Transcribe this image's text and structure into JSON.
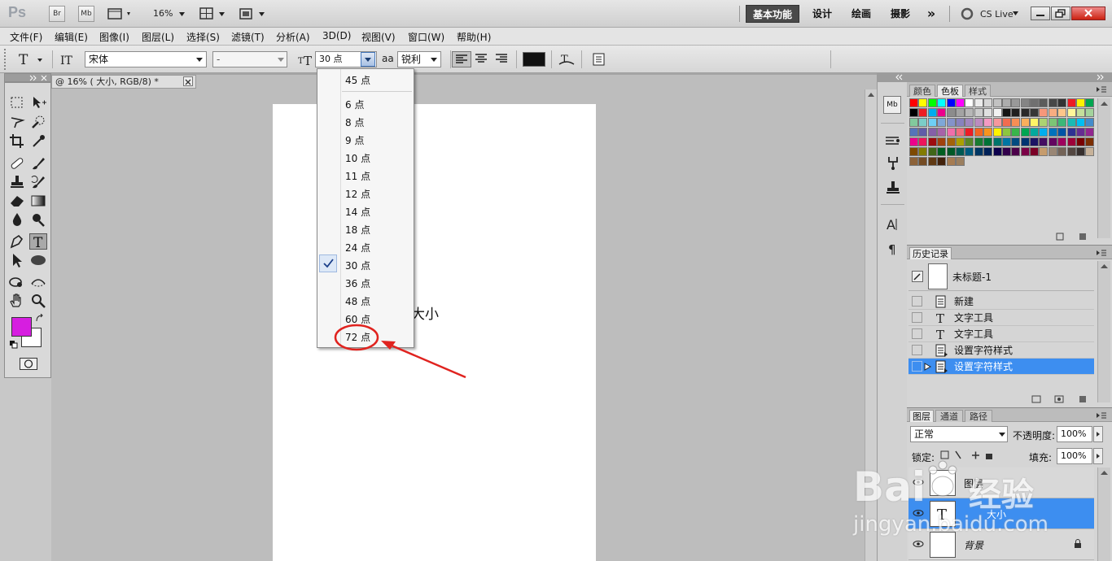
{
  "app": {
    "logo": "Ps",
    "bridge_btn": "Br",
    "minibridge_btn": "Mb",
    "zoom": "16%"
  },
  "workspaces": [
    {
      "label": "基本功能",
      "active": true
    },
    {
      "label": "设计",
      "active": false
    },
    {
      "label": "绘画",
      "active": false
    },
    {
      "label": "摄影",
      "active": false
    }
  ],
  "workspaces_more": "»",
  "cs_live": "CS Live",
  "menu": [
    "文件(F)",
    "编辑(E)",
    "图像(I)",
    "图层(L)",
    "选择(S)",
    "滤镜(T)",
    "分析(A)",
    "3D(D)",
    "视图(V)",
    "窗口(W)",
    "帮助(H)"
  ],
  "options": {
    "font_family": "宋体",
    "font_style": "-",
    "font_size": "30 点",
    "aa_label": "aa",
    "antialias": "锐利",
    "text_color": "#111111"
  },
  "document": {
    "tab_title": "@ 16% (        大小, RGB/8) *",
    "canvas_text": "大小"
  },
  "font_size_menu": {
    "top_item": "45 点",
    "items": [
      "6 点",
      "8 点",
      "9 点",
      "10 点",
      "11 点",
      "12 点",
      "14 点",
      "18 点",
      "24 点",
      "30 点",
      "36 点",
      "48 点",
      "60 点",
      "72 点"
    ],
    "checked": "30 点",
    "highlighted": "72 点"
  },
  "colors": {
    "foreground": "#d61ee0",
    "background": "#ffffff",
    "selection": "#3d8ef0",
    "annotation": "#e0231f"
  },
  "swatch_panel": {
    "tabs": [
      "颜色",
      "色板",
      "样式"
    ],
    "active_tab": "色板",
    "swatches": [
      "#ff0000",
      "#ffff00",
      "#00ff00",
      "#00ffff",
      "#0000ff",
      "#ff00ff",
      "#ffffff",
      "#ebebeb",
      "#d6d6d6",
      "#c2c2c2",
      "#adadad",
      "#999999",
      "#858585",
      "#707070",
      "#5c5c5c",
      "#474747",
      "#333333",
      "#ed1c24",
      "#fff200",
      "#00a651",
      "#000000",
      "#ee1d24",
      "#00adef",
      "#ec008c",
      "#8c8c8c",
      "#a3a3a3",
      "#b7b7b7",
      "#cccccc",
      "#e0e0e0",
      "#f2f2f2",
      "#141414",
      "#1f1f1f",
      "#292929",
      "#363636",
      "#f7977a",
      "#f9ad81",
      "#fdc68a",
      "#fff79a",
      "#c4df9b",
      "#a3d39c",
      "#82ca9d",
      "#7bcdc8",
      "#6ecff6",
      "#7ea7d8",
      "#8493ca",
      "#8882be",
      "#a187be",
      "#bc8cbf",
      "#f49ac2",
      "#f6989d",
      "#f26c4f",
      "#f68e55",
      "#fbaf5c",
      "#fff467",
      "#acd372",
      "#7cc576",
      "#3bb878",
      "#1abbb4",
      "#00bff3",
      "#438ccb",
      "#5574b9",
      "#605ca8",
      "#855fa8",
      "#a763a8",
      "#f06eaa",
      "#f26d7d",
      "#ed1c24",
      "#f26522",
      "#f7941d",
      "#fff200",
      "#8dc63f",
      "#39b54a",
      "#00a651",
      "#00a99d",
      "#00aeef",
      "#0072bc",
      "#0054a6",
      "#2e3192",
      "#662d91",
      "#92278f",
      "#ec008c",
      "#ed145b",
      "#9e0b0f",
      "#a0410d",
      "#a3620a",
      "#aba000",
      "#598527",
      "#197b30",
      "#007236",
      "#00746b",
      "#0076a3",
      "#004b80",
      "#003471",
      "#1b1464",
      "#440e62",
      "#630460",
      "#9e005d",
      "#9e0039",
      "#790000",
      "#7b2e00",
      "#7d4900",
      "#827b00",
      "#406618",
      "#005e20",
      "#005826",
      "#005952",
      "#005b7f",
      "#003663",
      "#002157",
      "#0d004c",
      "#32004b",
      "#4b0049",
      "#7b0046",
      "#7a0026",
      "#c69c6d",
      "#998675",
      "#736357",
      "#534741",
      "#362f2d",
      "#c7b299",
      "#8c6239",
      "#754c24",
      "#603913",
      "#42210b",
      "#a67c52",
      "#9b7f5f"
    ]
  },
  "history_panel": {
    "title": "历史记录",
    "snapshot": "未标题-1",
    "items": [
      {
        "label": "新建",
        "icon": "new-doc"
      },
      {
        "label": "文字工具",
        "icon": "type"
      },
      {
        "label": "文字工具",
        "icon": "type"
      },
      {
        "label": "设置字符样式",
        "icon": "char-style"
      },
      {
        "label": "设置字符样式",
        "icon": "char-style"
      }
    ],
    "selected_index": 4
  },
  "layers_panel": {
    "tabs": [
      "图层",
      "通道",
      "路径"
    ],
    "blend_mode": "正常",
    "opacity_label": "不透明度:",
    "opacity": "100%",
    "lock_label": "锁定:",
    "fill_label": "填充:",
    "fill": "100%",
    "layers": [
      {
        "name": "图层",
        "type": "normal",
        "selected": false
      },
      {
        "name": "大小",
        "type": "text",
        "selected": true
      },
      {
        "name": "背景",
        "type": "background",
        "selected": false
      }
    ]
  },
  "watermark": {
    "brand": "Bai",
    "site": "jingyan.baidu.com",
    "cn": "经验"
  }
}
